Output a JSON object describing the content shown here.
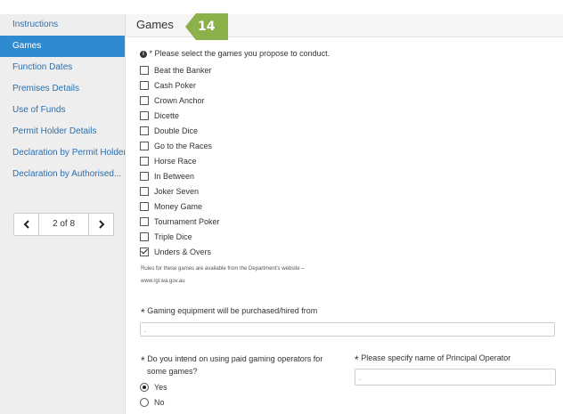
{
  "sidebar": {
    "items": [
      {
        "label": "Instructions"
      },
      {
        "label": "Games"
      },
      {
        "label": "Function Dates"
      },
      {
        "label": "Premises Details"
      },
      {
        "label": "Use of Funds"
      },
      {
        "label": "Permit Holder Details"
      },
      {
        "label": "Declaration by Permit Holder"
      },
      {
        "label": "Declaration by Authorised..."
      }
    ],
    "active_index": 1,
    "pager": {
      "prev_icon": "chevron-left-icon",
      "text": "2 of 8",
      "next_icon": "chevron-right-icon"
    }
  },
  "header": {
    "title": "Games"
  },
  "badge": {
    "text": "14",
    "color": "#8cb04a"
  },
  "games": {
    "required_mark": "*",
    "instruction": "Please select the games you propose to conduct.",
    "options": [
      {
        "label": "Beat the Banker",
        "checked": false
      },
      {
        "label": "Cash Poker",
        "checked": false
      },
      {
        "label": "Crown Anchor",
        "checked": false
      },
      {
        "label": "Dicette",
        "checked": false
      },
      {
        "label": "Double Dice",
        "checked": false
      },
      {
        "label": "Go to the Races",
        "checked": false
      },
      {
        "label": "Horse Race",
        "checked": false
      },
      {
        "label": "In Between",
        "checked": false
      },
      {
        "label": "Joker Seven",
        "checked": false
      },
      {
        "label": "Money Game",
        "checked": false
      },
      {
        "label": "Tournament Poker",
        "checked": false
      },
      {
        "label": "Triple Dice",
        "checked": false
      },
      {
        "label": "Unders & Overs",
        "checked": true
      }
    ],
    "rules_line1": "Rules for these games are available from the Department's website –",
    "rules_line2": "www.rgl.wa.gov.au"
  },
  "equipment": {
    "label": "Gaming equipment will be purchased/hired from",
    "value": "."
  },
  "operators": {
    "question_line1": "Do you intend on using paid gaming operators for",
    "question_line2": "some games?",
    "options": [
      {
        "label": "Yes",
        "selected": true
      },
      {
        "label": "No",
        "selected": false
      }
    ],
    "principal_label": "Please specify name of Principal Operator",
    "principal_value": "."
  },
  "colors": {
    "active_nav": "#2f8bd0",
    "link": "#2a6fb0",
    "sidebar_bg": "#eeeeee"
  }
}
